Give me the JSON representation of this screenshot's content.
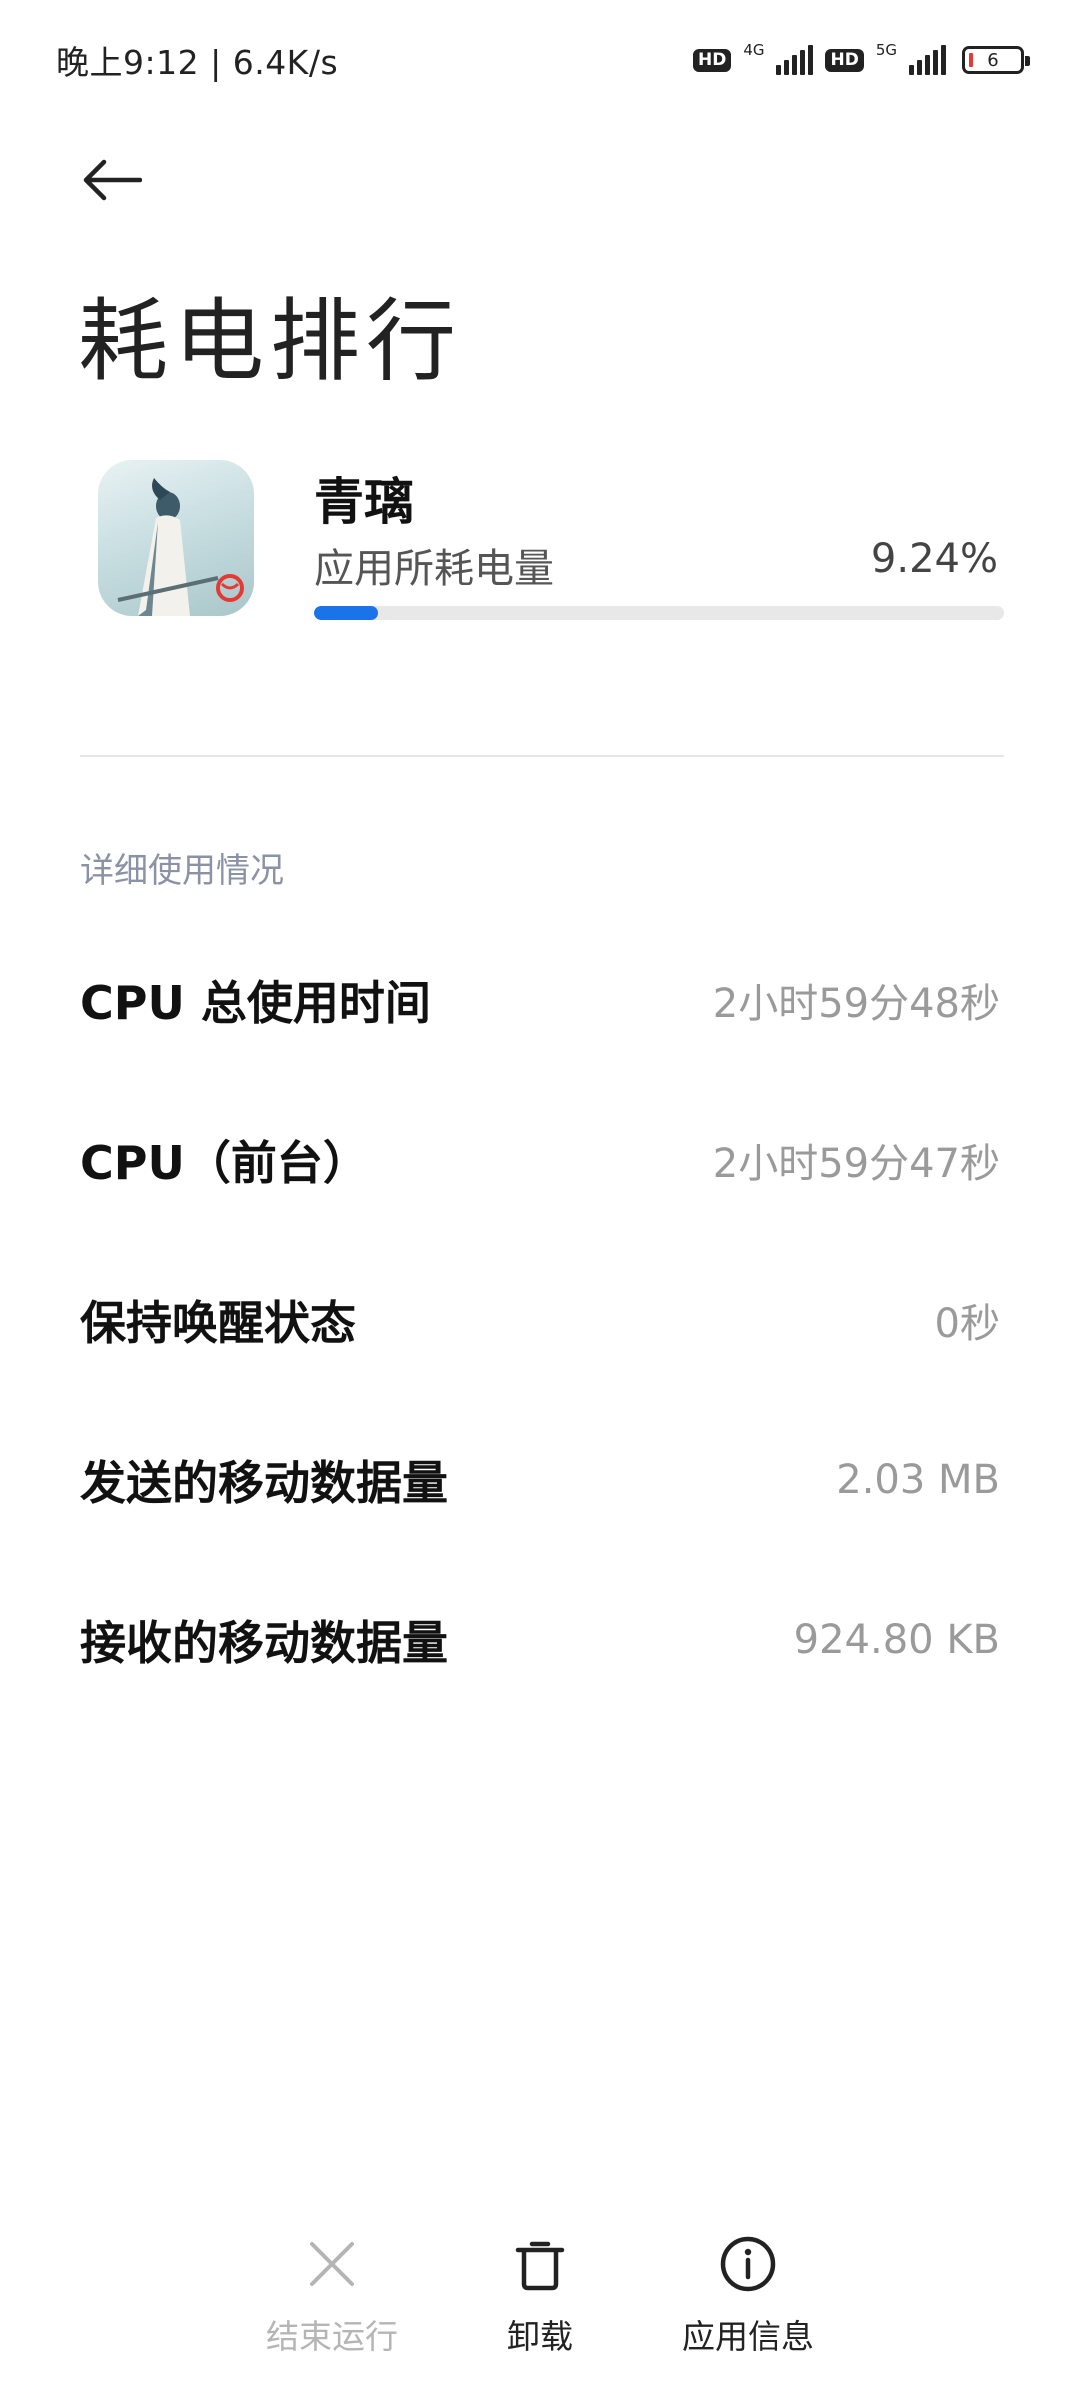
{
  "status_bar": {
    "time_speed": "晚上9:12 | 6.4K/s",
    "hd_1": "HD",
    "net_1": "4G",
    "hd_2": "HD",
    "net_2": "5G",
    "battery_level": "6",
    "battery_icon": "battery-icon"
  },
  "header": {
    "back_icon": "back-arrow-icon",
    "title": "耗电排行"
  },
  "app": {
    "name": "青璃",
    "usage_label": "应用所耗电量",
    "usage_percent": "9.24%",
    "usage_fraction": 0.0924,
    "accent_color": "#1a73e8"
  },
  "details": {
    "section_title": "详细使用情况",
    "rows": [
      {
        "label": "CPU 总使用时间",
        "value": "2小时59分48秒"
      },
      {
        "label": "CPU（前台）",
        "value": "2小时59分47秒"
      },
      {
        "label": "保持唤醒状态",
        "value": "0秒"
      },
      {
        "label": "发送的移动数据量",
        "value": "2.03 MB"
      },
      {
        "label": "接收的移动数据量",
        "value": "924.80 KB"
      }
    ]
  },
  "actions": {
    "force_stop": {
      "label": "结束运行",
      "icon": "close-icon",
      "enabled": false
    },
    "uninstall": {
      "label": "卸载",
      "icon": "trash-icon",
      "enabled": true
    },
    "app_info": {
      "label": "应用信息",
      "icon": "info-icon",
      "enabled": true
    }
  }
}
